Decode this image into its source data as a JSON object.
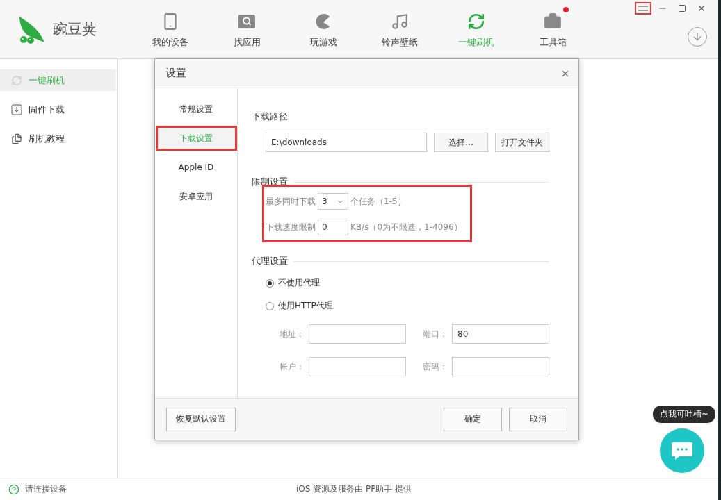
{
  "app": {
    "logo_text": "豌豆荚"
  },
  "nav": [
    {
      "label": "我的设备",
      "kind": "device",
      "selected": false,
      "badge": false
    },
    {
      "label": "找应用",
      "kind": "apps",
      "selected": false,
      "badge": false
    },
    {
      "label": "玩游戏",
      "kind": "games",
      "selected": false,
      "badge": false
    },
    {
      "label": "铃声壁纸",
      "kind": "music",
      "selected": false,
      "badge": false
    },
    {
      "label": "一键刷机",
      "kind": "flash",
      "selected": true,
      "badge": false
    },
    {
      "label": "工具箱",
      "kind": "tools",
      "selected": false,
      "badge": true
    }
  ],
  "window_controls": {
    "menu_highlighted": true
  },
  "sidebar": [
    {
      "label": "一键刷机",
      "kind": "flash",
      "selected": true
    },
    {
      "label": "固件下载",
      "kind": "download",
      "selected": false
    },
    {
      "label": "刷机教程",
      "kind": "guide",
      "selected": false
    }
  ],
  "dialog": {
    "title": "设置",
    "tabs": [
      {
        "label": "常规设置",
        "selected": false,
        "highlighted": false
      },
      {
        "label": "下载设置",
        "selected": true,
        "highlighted": true
      },
      {
        "label": "Apple ID",
        "selected": false,
        "highlighted": false
      },
      {
        "label": "安卓应用",
        "selected": false,
        "highlighted": false
      }
    ],
    "download_path": {
      "title": "下载路径",
      "value": "E:\\downloads",
      "buttons": [
        "选择...",
        "打开文件夹"
      ]
    },
    "limits": {
      "title": "限制设置",
      "highlighted": true,
      "max_label": "最多同时下载",
      "max_value": "3",
      "max_suffix": "个任务（1-5）",
      "speed_label": "下载速度限制",
      "speed_value": "0",
      "speed_suffix": "KB/s（0为不限速，1-4096）"
    },
    "proxy": {
      "title": "代理设置",
      "options": [
        {
          "label": "不使用代理",
          "selected": true
        },
        {
          "label": "使用HTTP代理",
          "selected": false
        }
      ],
      "fields": [
        {
          "label": "地址："
        },
        {
          "label": "端口：",
          "value": "80"
        },
        {
          "label": "帐户："
        },
        {
          "label": "密码："
        }
      ]
    },
    "footer": {
      "reset": "恢复默认设置",
      "ok": "确定",
      "cancel": "取消"
    }
  },
  "status_bar": {
    "left": "请连接设备",
    "center": "iOS 资源及服务由 PP助手 提供"
  },
  "feedback": {
    "tooltip": "点我可吐槽~"
  }
}
